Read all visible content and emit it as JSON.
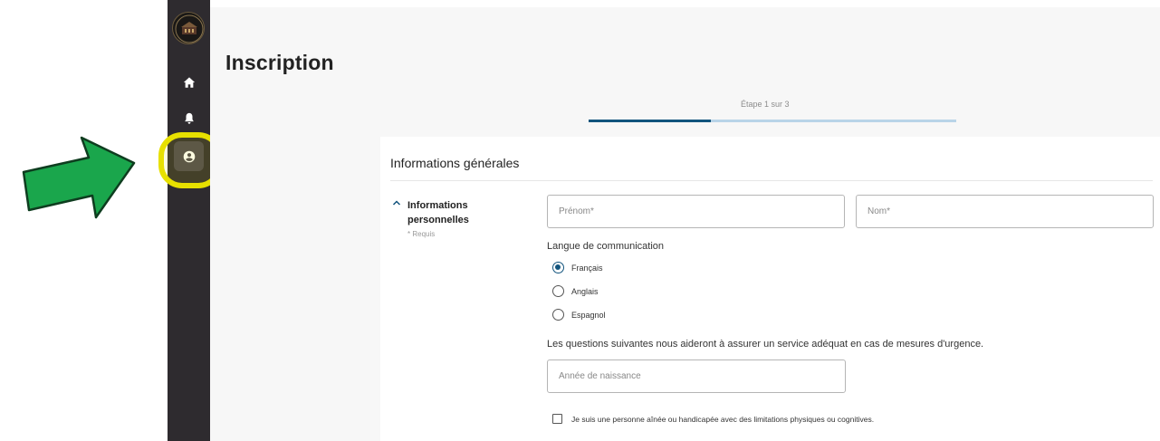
{
  "page": {
    "title": "Inscription",
    "step_text": "Étape 1 sur 3",
    "step_current": 1,
    "step_total": 3
  },
  "nav": {
    "items": [
      "home-icon",
      "bell-icon",
      "user-circle-icon"
    ],
    "active": "user-circle-icon"
  },
  "colors": {
    "sidebar_bg": "#2e2b2f",
    "accent": "#12547d",
    "progress_track": "#b9d4e8",
    "highlight": "#e7e000",
    "arrow_fill": "#1aa64c"
  },
  "section": {
    "title": "Informations générales",
    "subsection": {
      "label": "Informations personnelles",
      "required_note": "* Requis"
    }
  },
  "form": {
    "first_name_placeholder": "Prénom*",
    "last_name_placeholder": "Nom*",
    "language_label": "Langue de communication",
    "languages": [
      "Français",
      "Anglais",
      "Espagnol"
    ],
    "selected_language": "Français",
    "help_text": "Les questions suivantes nous aideront à assurer un service adéquat en cas de mesures d'urgence.",
    "birth_year_placeholder": "Année de naissance",
    "senior_checkbox_label": "Je suis une personne aînée ou handicapée avec des limitations physiques ou cognitives.",
    "senior_checked": false
  }
}
